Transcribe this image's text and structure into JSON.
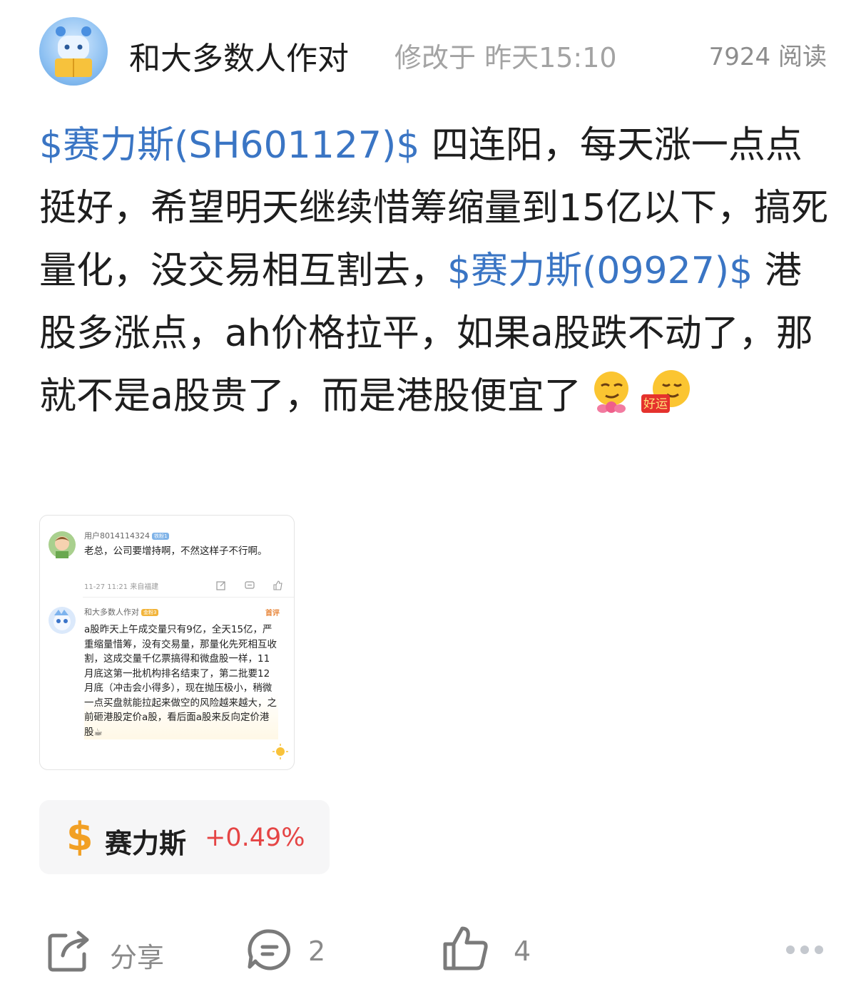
{
  "header": {
    "author": "和大多数人作对",
    "modified": "修改于 昨天15:10",
    "reads": "7924 阅读"
  },
  "post": {
    "stock1": "$赛力斯(SH601127)$",
    "text1": " 四连阳，每天涨一点点挺好，希望明天继续惜筹缩量到15亿以下，搞死量化，没交易相互割去，",
    "stock2": "$赛力斯(09927)$",
    "text2": " 港股多涨点，ah价格拉平，如果a股跌不动了，那就不是a股贵了，而是港股便宜了",
    "emoji1": "smirk-lotus-emoji",
    "emoji2": "good-luck-emoji",
    "emoji2_text": "好运"
  },
  "card": {
    "comment1": {
      "user": "用户8014114324",
      "tag": "铁粉1",
      "text": "老总，公司要增持啊，不然这样子不行啊。",
      "meta": "11-27 11:21 来自福建"
    },
    "comment2": {
      "user": "和大多数人作对",
      "tag": "金粉3",
      "badge": "首评",
      "text": "a股昨天上午成交量只有9亿，全天15亿，严重缩量惜筹，没有交易量，那量化先死相互收割，这成交量千亿票搞得和微盘股一样，11月底这第一批机构排名结束了，第二批要12月底（冲击会小得多），现在抛压极小，稍微一点买盘就能拉起来做空的风险越来越大，之前砸港股定价a股，看后面a股来反向定价港股☕"
    }
  },
  "stock_chip": {
    "icon": "$",
    "name": "赛力斯",
    "change": "+0.49%"
  },
  "actions": {
    "share_label": "分享",
    "comment_count": "2",
    "like_count": "4"
  },
  "colors": {
    "link": "#3a75c4",
    "up": "#e54545",
    "chip_icon": "#f2a024"
  }
}
